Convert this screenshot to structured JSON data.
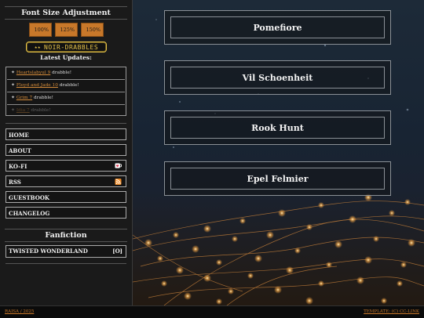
{
  "font_size": {
    "heading": "Font Size Adjustment",
    "options": [
      "100%",
      "125%",
      "150%"
    ]
  },
  "badge": {
    "stars": "★★",
    "label": "NOIR-DRABBLES"
  },
  "updates": {
    "title": "Latest Updates:",
    "items": [
      {
        "link": "Heartslabyul 9",
        "suffix": " drabble!"
      },
      {
        "link": "Floyd and Jade 10",
        "suffix": " drabble!"
      },
      {
        "link": "Grim 7",
        "suffix": " drabble!"
      },
      {
        "link": "Idia 7",
        "suffix": " drabble!"
      }
    ]
  },
  "nav": {
    "home": "HOME",
    "about": "ABOUT",
    "kofi": "KO-FI",
    "rss": "RSS",
    "guestbook": "GUESTBOOK",
    "changelog": "CHANGELOG"
  },
  "fanfiction": {
    "heading": "Fanfiction",
    "item": "TWISTED WONDERLAND",
    "count": "[O]"
  },
  "characters": [
    "Pomefiore",
    "Vil Schoenheit",
    "Rook Hunt",
    "Epel Felmier"
  ],
  "footer": {
    "left": "RAISA / 2025",
    "right": "TEMPLATE: (C) CC-LINK"
  },
  "colors": {
    "accent": "#c8782a",
    "badge": "#e6c34a",
    "sidebar": "#1a1a1a"
  }
}
